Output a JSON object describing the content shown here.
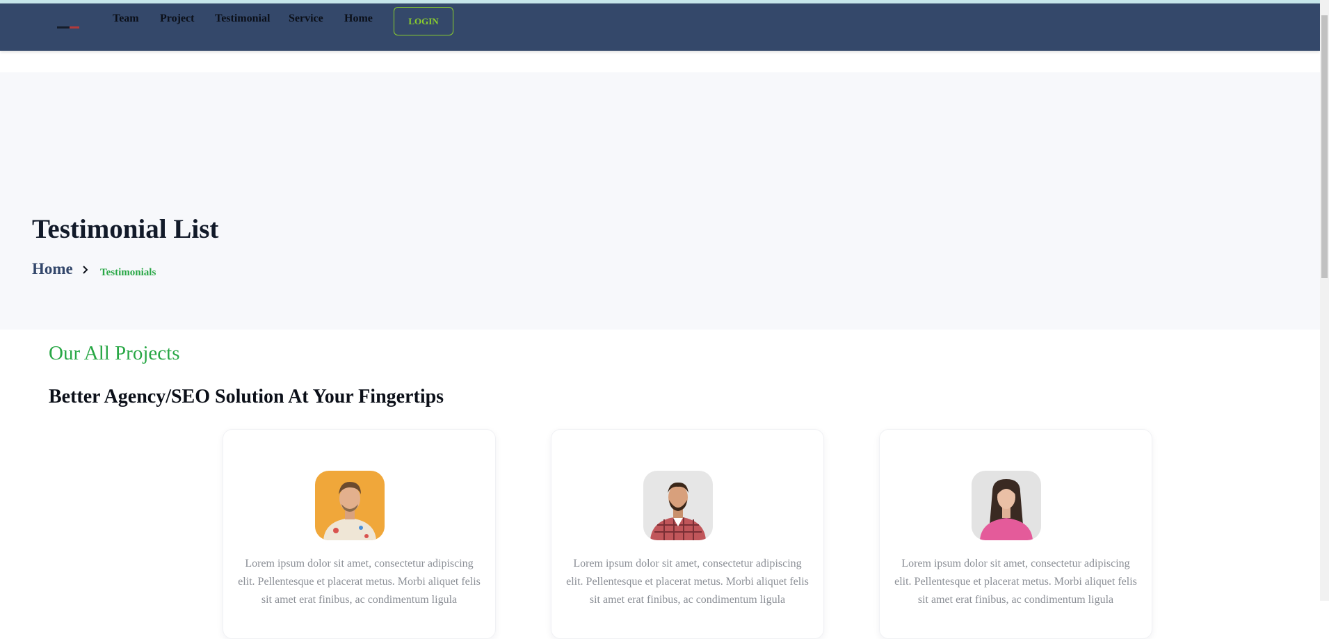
{
  "nav": {
    "items": [
      {
        "label": "Team"
      },
      {
        "label": "Project"
      },
      {
        "label": "Testimonial"
      },
      {
        "label": "Service"
      },
      {
        "label": "Home"
      }
    ],
    "login_label": "LOGIN"
  },
  "hero": {
    "title": "Testimonial List",
    "breadcrumb": {
      "home": "Home",
      "current": "Testimonials"
    }
  },
  "section": {
    "eyebrow": "Our All Projects",
    "heading": "Better Agency/SEO Solution At Your Fingertips"
  },
  "testimonials": [
    {
      "text": "Lorem ipsum dolor sit amet, consectetur adipiscing elit. Pellentesque et placerat metus. Morbi aliquet felis sit amet erat finibus, ac condimentum ligula"
    },
    {
      "text": "Lorem ipsum dolor sit amet, consectetur adipiscing elit. Pellentesque et placerat metus. Morbi aliquet felis sit amet erat finibus, ac condimentum ligula"
    },
    {
      "text": "Lorem ipsum dolor sit amet, consectetur adipiscing elit. Pellentesque et placerat metus. Morbi aliquet felis sit amet erat finibus, ac condimentum ligula"
    }
  ],
  "colors": {
    "navbar_bg": "#34486a",
    "accent_green": "#28a745",
    "login_green": "#8ccf2d",
    "hero_bg": "#f7f8fb"
  }
}
